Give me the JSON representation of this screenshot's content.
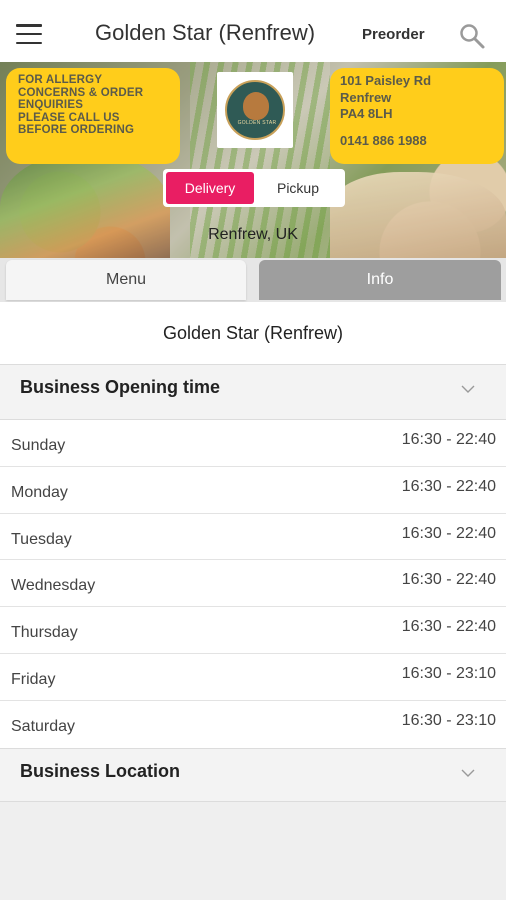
{
  "header": {
    "title": "Golden Star (Renfrew)",
    "preorder_label": "Preorder",
    "menu_icon": "hamburger-icon",
    "search_icon": "search-icon"
  },
  "banner": {
    "allergy_notice": [
      "FOR ALLERGY",
      "CONCERNS & ORDER",
      "ENQUIRIES",
      "PLEASE CALL US",
      "BEFORE ORDERING"
    ],
    "address_lines": [
      "101 Paisley Rd",
      "Renfrew",
      "PA4 8LH"
    ],
    "phone": "0141 886 1988",
    "logo_text": "GOLDEN STAR",
    "location": "Renfrew, UK",
    "accent_color": "#ffcd1b"
  },
  "order_toggle": {
    "delivery_label": "Delivery",
    "pickup_label": "Pickup",
    "selected": "Delivery",
    "active_color": "#e91e63"
  },
  "tabs": {
    "menu_label": "Menu",
    "info_label": "Info",
    "selected": "Info"
  },
  "info": {
    "business_name": "Golden Star (Renfrew)",
    "opening_title": "Business Opening time",
    "hours": [
      {
        "day": "Sunday",
        "time": "16:30 - 22:40"
      },
      {
        "day": "Monday",
        "time": "16:30 - 22:40"
      },
      {
        "day": "Tuesday",
        "time": "16:30 - 22:40"
      },
      {
        "day": "Wednesday",
        "time": "16:30 - 22:40"
      },
      {
        "day": "Thursday",
        "time": "16:30 - 22:40"
      },
      {
        "day": "Friday",
        "time": "16:30 - 23:10"
      },
      {
        "day": "Saturday",
        "time": "16:30 - 23:10"
      }
    ],
    "location_title": "Business Location"
  }
}
